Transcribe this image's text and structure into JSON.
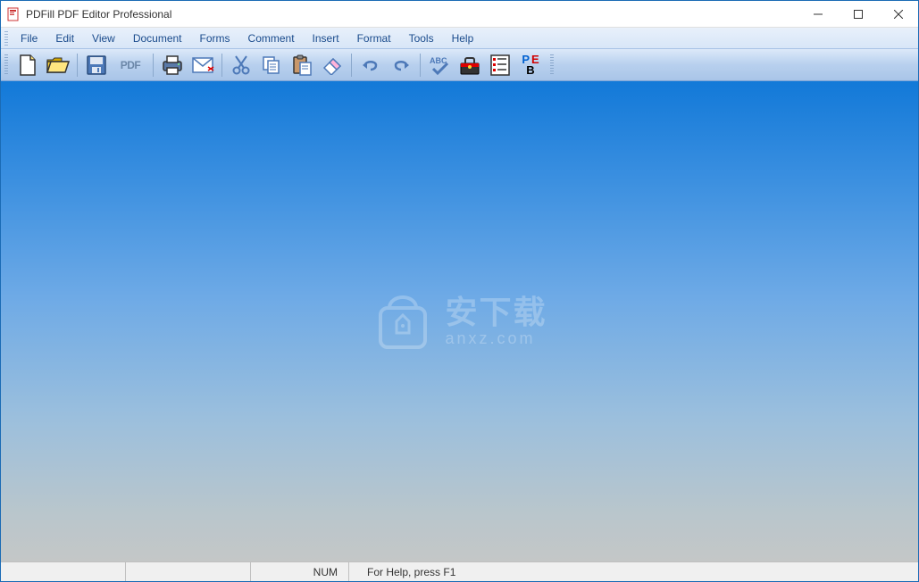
{
  "titlebar": {
    "title": "PDFill PDF Editor Professional"
  },
  "menubar": {
    "items": [
      "File",
      "Edit",
      "View",
      "Document",
      "Forms",
      "Comment",
      "Insert",
      "Format",
      "Tools",
      "Help"
    ]
  },
  "toolbar": {
    "pdf_label": "PDF",
    "abc_label": "ABC",
    "pe_label_p": "P",
    "pe_label_e": "E",
    "pe_label_b": "B"
  },
  "statusbar": {
    "num": "NUM",
    "help": "For Help, press F1"
  },
  "watermark": {
    "line1": "安下载",
    "line2": "anxz.com"
  }
}
